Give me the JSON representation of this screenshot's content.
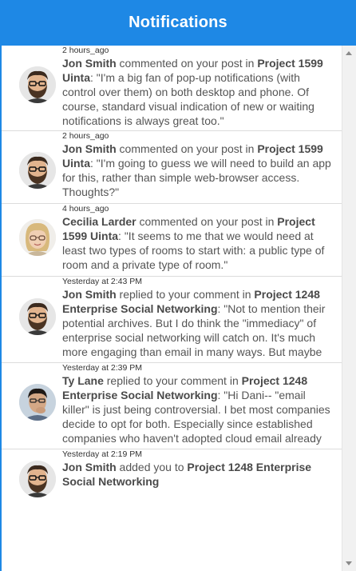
{
  "header": {
    "title": "Notifications"
  },
  "notifications": [
    {
      "time": "2 hours_ago",
      "actor": "Jon Smith",
      "action": " commented on your post in ",
      "project": "Project 1599 Uinta",
      "sep": ": ",
      "text": "\"I'm a big fan of pop-up notifications (with control over them) on both desktop and phone. Of course, standard visual indication of new or waiting notifications is always great too.\"",
      "avatar": "man-beard-glasses"
    },
    {
      "time": "2 hours_ago",
      "actor": "Jon Smith",
      "action": " commented on your post in ",
      "project": "Project 1599 Uinta",
      "sep": ": ",
      "text": "\"I'm going to guess we will need to build an app for this, rather than simple web-browser access. Thoughts?\"",
      "avatar": "man-beard-glasses"
    },
    {
      "time": "4 hours_ago",
      "actor": "Cecilia Larder",
      "action": " commented on your post in ",
      "project": "Project 1599 Uinta",
      "sep": ": ",
      "text": "\"It seems to me that we would need at least two types of rooms to start with: a public type of room and a private type of room.\"",
      "avatar": "woman-blonde-glasses"
    },
    {
      "time": "Yesterday at 2:43 PM",
      "actor": "Jon Smith",
      "action": " replied to your comment in ",
      "project": "Project 1248 Enterprise Social Networking",
      "sep": ": ",
      "text": "\"Not to mention their potential archives. But I do think the \"immediacy\" of enterprise social networking will catch on. It's much more engaging than email in many ways. But maybe",
      "avatar": "man-beard-glasses"
    },
    {
      "time": "Yesterday at 2:39 PM",
      "actor": "Ty Lane",
      "action": " replied to your comment in ",
      "project": "Project 1248 Enterprise Social Networking",
      "sep": ": ",
      "text": "\"Hi Dani-- \"email killer\" is just being controversial. I bet most companies decide to opt for both. Especially since established companies who haven't adopted cloud email already",
      "avatar": "man-dark-hair"
    },
    {
      "time": "Yesterday at 2:19 PM",
      "actor": "Jon Smith",
      "action": " added you to ",
      "project": "Project 1248 Enterprise Social Networking",
      "sep": "",
      "text": "",
      "avatar": "man-beard-glasses"
    }
  ],
  "colors": {
    "header": "#1e88e5",
    "text": "#555555"
  }
}
